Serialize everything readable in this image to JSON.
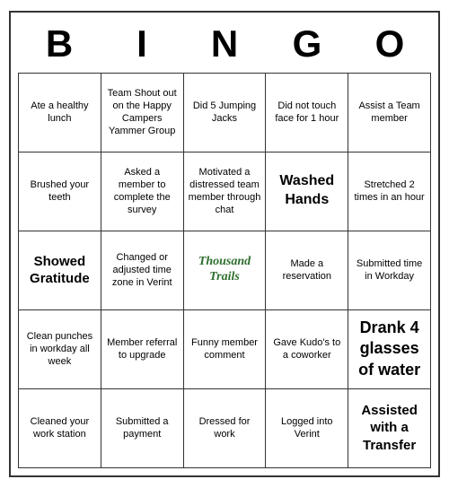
{
  "header": {
    "letters": [
      "B",
      "I",
      "N",
      "G",
      "O"
    ]
  },
  "cells": [
    {
      "text": "Ate a healthy lunch",
      "style": "normal"
    },
    {
      "text": "Team Shout out on the Happy Campers Yammer Group",
      "style": "small"
    },
    {
      "text": "Did 5 Jumping Jacks",
      "style": "normal"
    },
    {
      "text": "Did not touch face for 1 hour",
      "style": "normal"
    },
    {
      "text": "Assist a Team member",
      "style": "normal"
    },
    {
      "text": "Brushed your teeth",
      "style": "normal"
    },
    {
      "text": "Asked a member to complete the survey",
      "style": "small"
    },
    {
      "text": "Motivated a distressed team member through chat",
      "style": "small"
    },
    {
      "text": "Washed Hands",
      "style": "large"
    },
    {
      "text": "Stretched 2 times in an hour",
      "style": "normal"
    },
    {
      "text": "Showed Gratitude",
      "style": "bold"
    },
    {
      "text": "Changed or adjusted time zone in Verint",
      "style": "small"
    },
    {
      "text": "THOUSAND_TRAILS",
      "style": "special"
    },
    {
      "text": "Made a reservation",
      "style": "normal"
    },
    {
      "text": "Submitted time in Workday",
      "style": "normal"
    },
    {
      "text": "Clean punches in workday all week",
      "style": "normal"
    },
    {
      "text": "Member referral to upgrade",
      "style": "normal"
    },
    {
      "text": "Funny member comment",
      "style": "normal"
    },
    {
      "text": "Gave Kudo's to a coworker",
      "style": "normal"
    },
    {
      "text": "Drank 4 glasses of water",
      "style": "bold-large"
    },
    {
      "text": "Cleaned your work station",
      "style": "normal"
    },
    {
      "text": "Submitted a payment",
      "style": "normal"
    },
    {
      "text": "Dressed for work",
      "style": "normal"
    },
    {
      "text": "Logged into Verint",
      "style": "normal"
    },
    {
      "text": "Assisted with a Transfer",
      "style": "bold"
    }
  ]
}
